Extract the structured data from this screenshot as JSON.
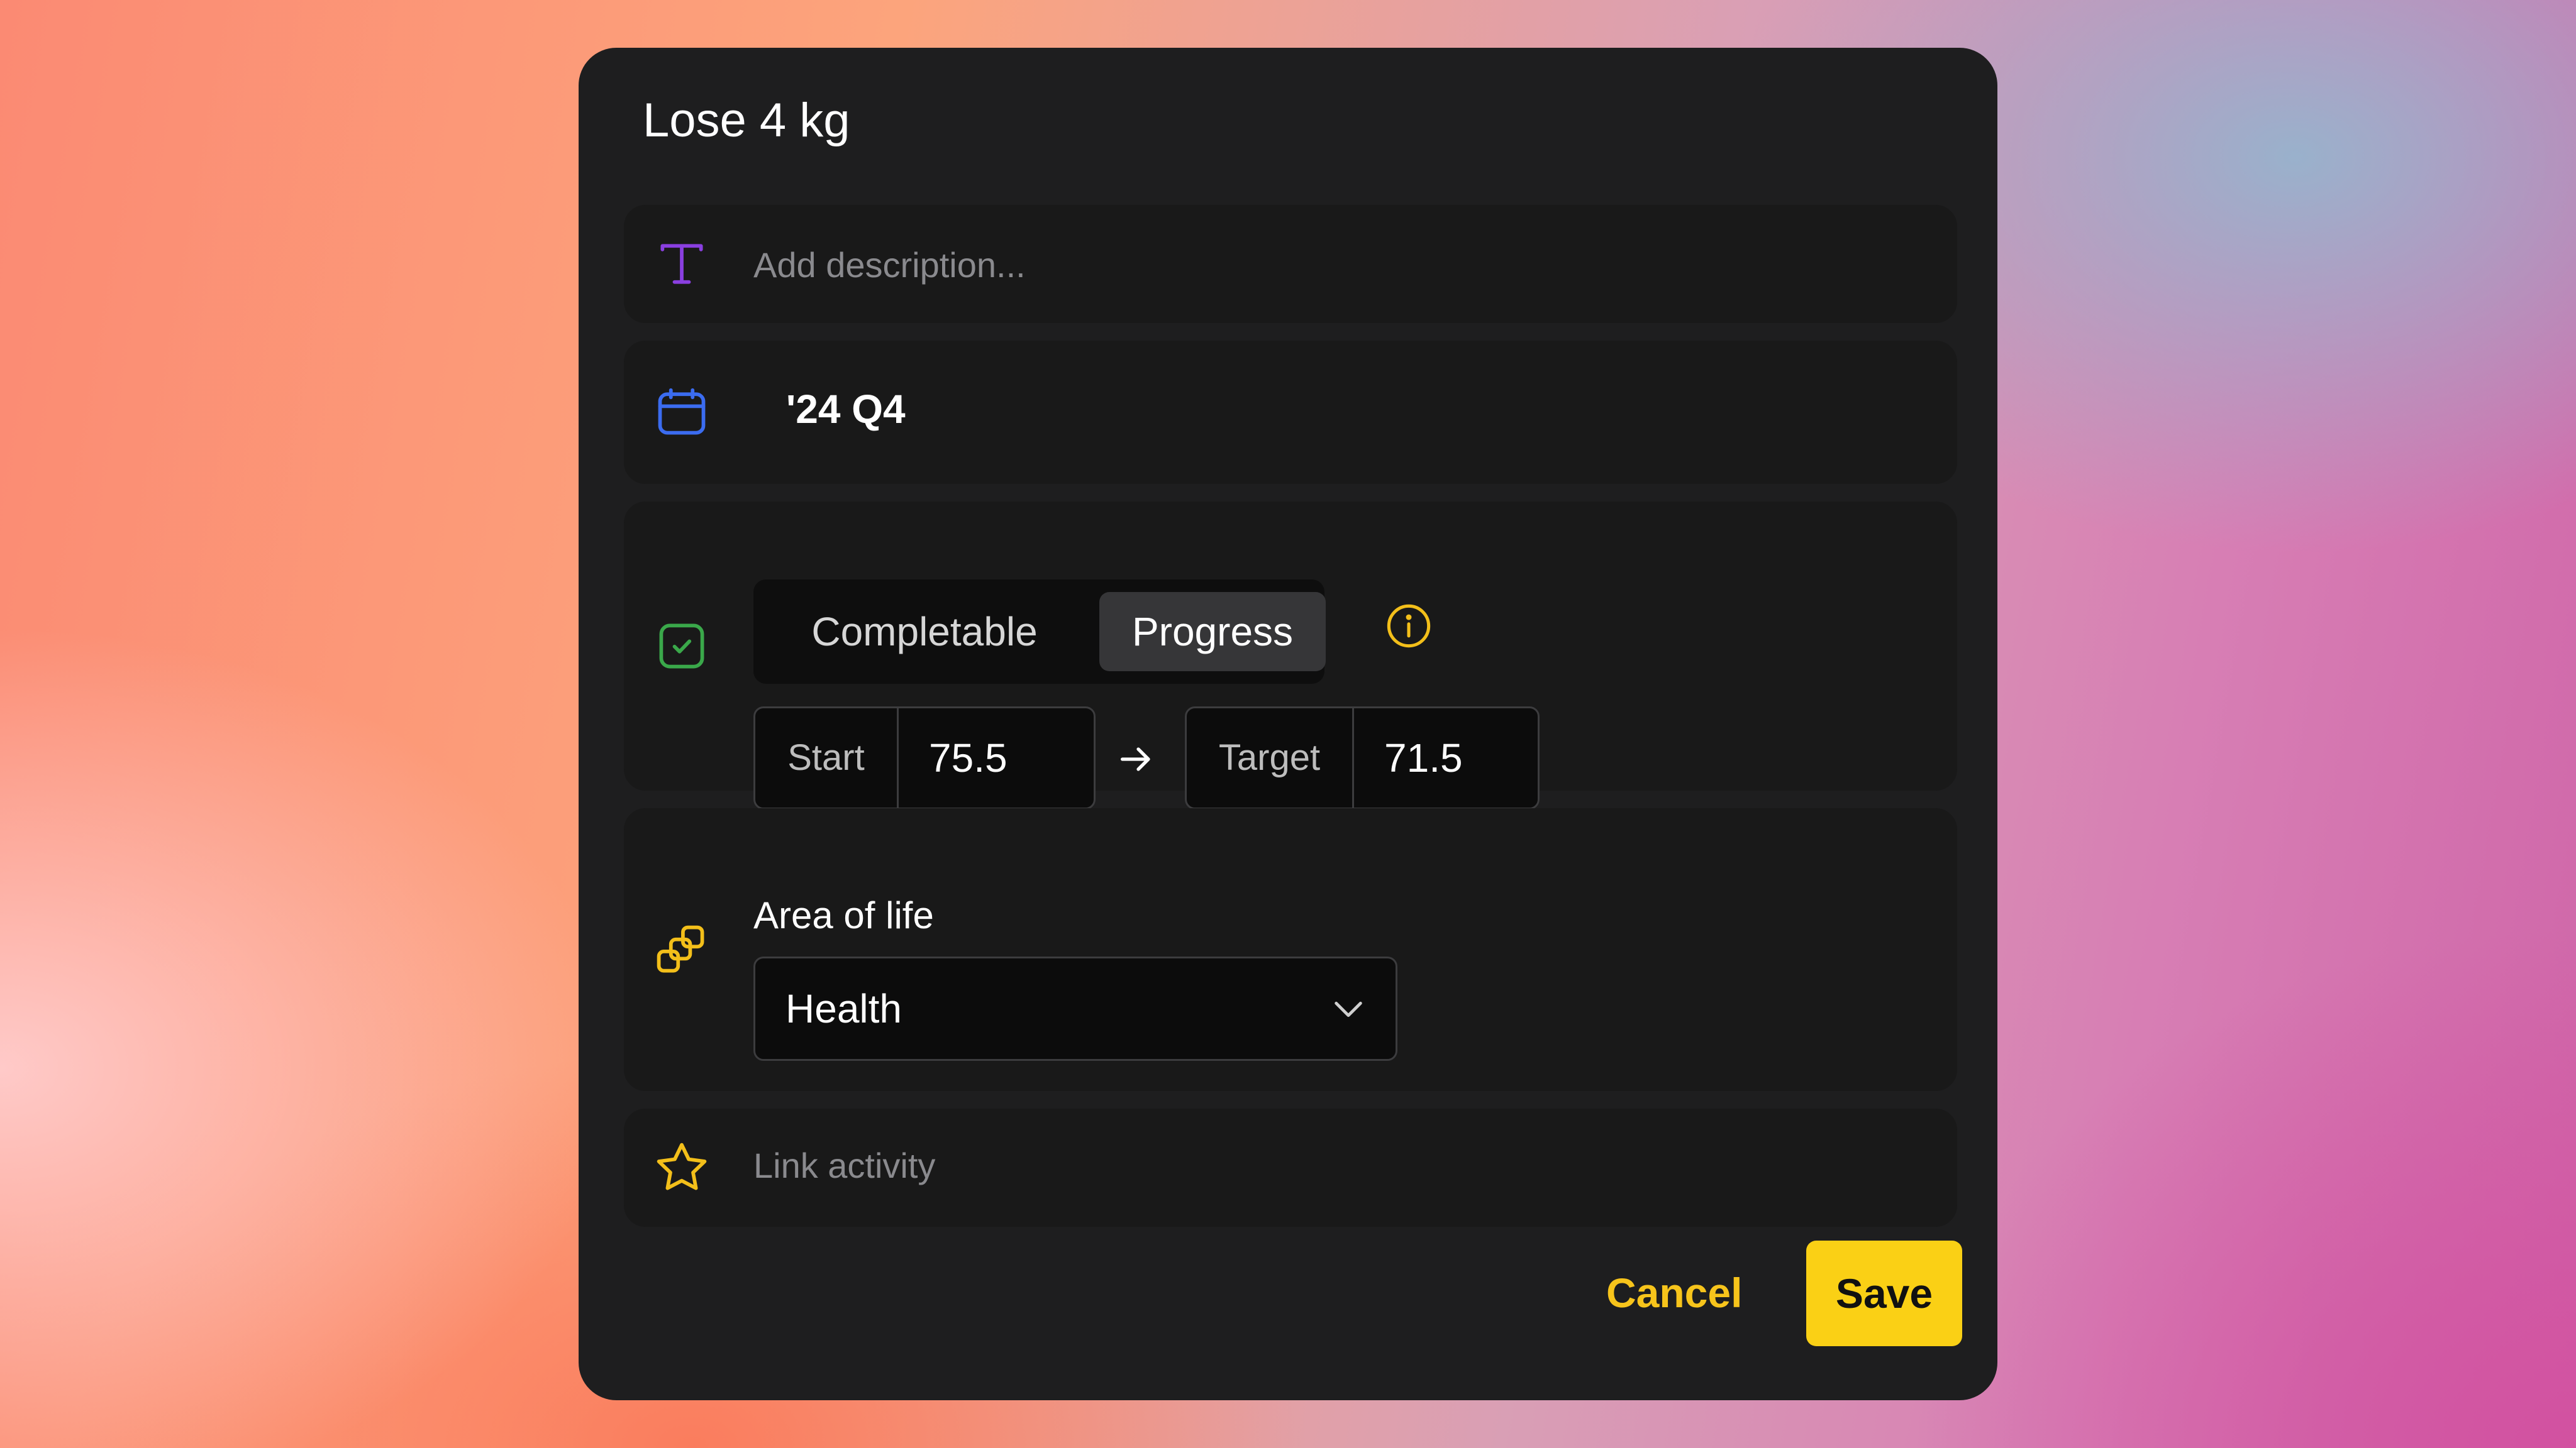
{
  "dialog": {
    "title": "Lose 4 kg"
  },
  "description": {
    "icon": "text-t-icon",
    "placeholder": "Add description...",
    "value": ""
  },
  "timeframe": {
    "icon": "calendar-icon",
    "value": "'24 Q4"
  },
  "goal_type": {
    "icon": "checkbox-check-icon",
    "options": [
      "Completable",
      "Progress"
    ],
    "selected": "Progress",
    "info_icon": "info-circle-icon",
    "start_label": "Start",
    "start_value": "75.5",
    "target_label": "Target",
    "target_value": "71.5",
    "arrow_icon": "arrow-right-icon"
  },
  "area_of_life": {
    "icon": "overlapping-squares-icon",
    "label": "Area of life",
    "selected": "Health"
  },
  "link_activity": {
    "icon": "star-icon",
    "label": "Link activity"
  },
  "actions": {
    "cancel_label": "Cancel",
    "save_label": "Save"
  },
  "colors": {
    "dialog_bg": "#1e1e1f",
    "row_bg": "#191919",
    "accent_yellow": "#fad015",
    "text_icon_purple": "#8a3fe0",
    "calendar_blue": "#3b6cf0",
    "check_green": "#3aa84a"
  }
}
